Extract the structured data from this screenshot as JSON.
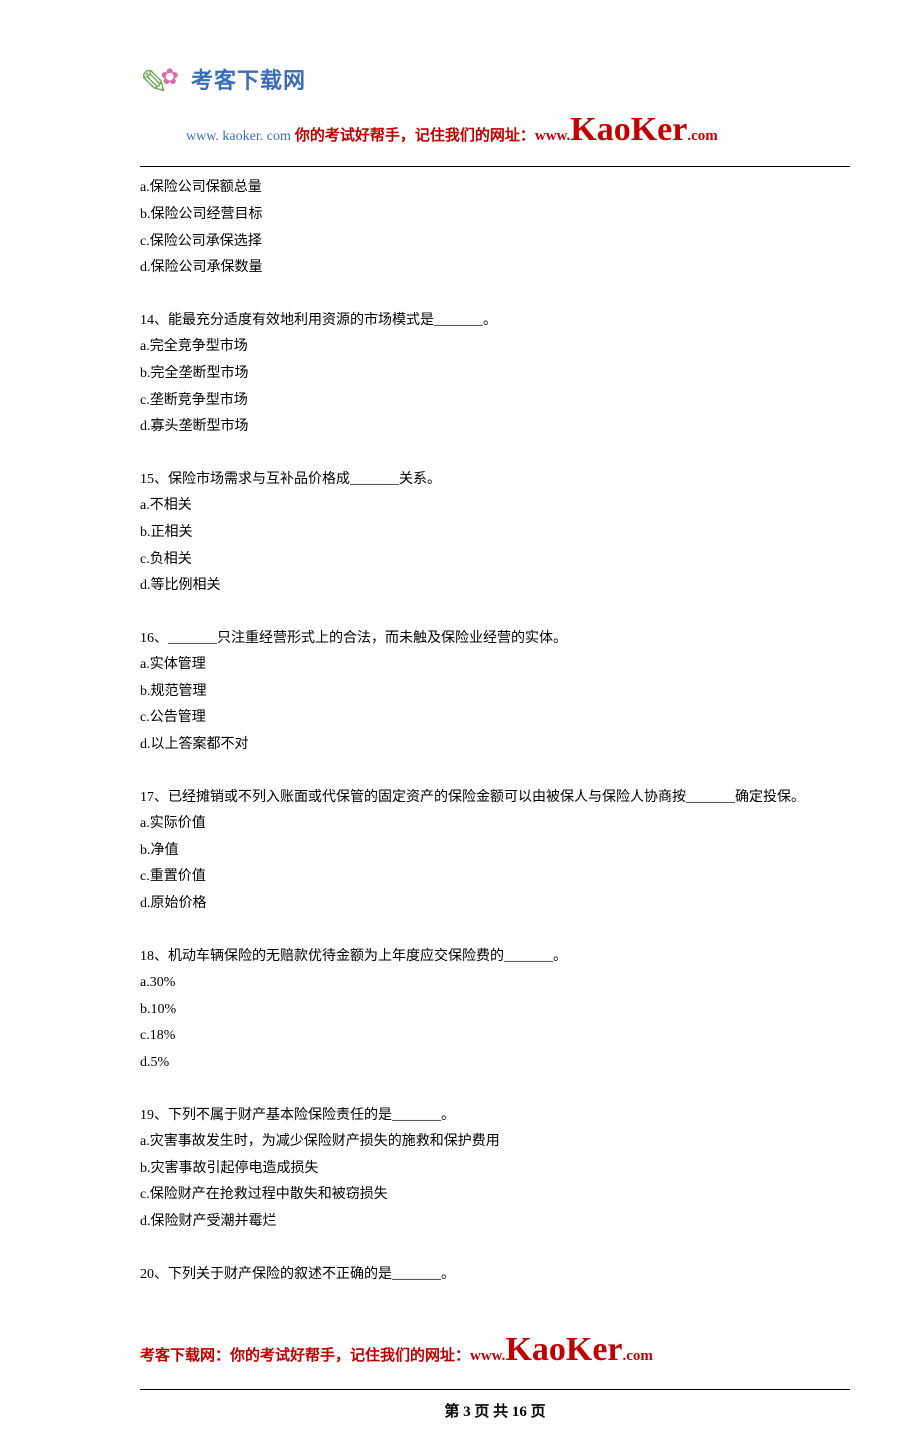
{
  "header": {
    "site_name_cn": "考客下载网",
    "site_url_small": "www. kaoker. com",
    "tagline_prefix": "你的考试好帮手，记住我们的网址：",
    "www": "www.",
    "brand": "KaoKer",
    "dotcom": ".com"
  },
  "prelude": {
    "a": "a.保险公司保额总量",
    "b": "b.保险公司经营目标",
    "c": "c.保险公司承保选择",
    "d": "d.保险公司承保数量"
  },
  "q14": {
    "stem": "14、能最充分适度有效地利用资源的市场模式是_______。",
    "a": "a.完全竞争型市场",
    "b": "b.完全垄断型市场",
    "c": "c.垄断竞争型市场",
    "d": "d.寡头垄断型市场"
  },
  "q15": {
    "stem": "15、保险市场需求与互补品价格成_______关系。",
    "a": "a.不相关",
    "b": "b.正相关",
    "c": "c.负相关",
    "d": "d.等比例相关"
  },
  "q16": {
    "stem": "16、_______只注重经营形式上的合法，而未触及保险业经营的实体。",
    "a": "a.实体管理",
    "b": "b.规范管理",
    "c": "c.公告管理",
    "d": "d.以上答案都不对"
  },
  "q17": {
    "stem": "17、已经摊销或不列入账面或代保管的固定资产的保险金额可以由被保人与保险人协商按_______确定投保。",
    "a": "a.实际价值",
    "b": "b.净值",
    "c": "c.重置价值",
    "d": "d.原始价格"
  },
  "q18": {
    "stem": "18、机动车辆保险的无赔款优待金额为上年度应交保险费的_______。",
    "a": "a.30%",
    "b": "b.10%",
    "c": "c.18%",
    "d": "d.5%"
  },
  "q19": {
    "stem": "19、下列不属于财产基本险保险责任的是_______。",
    "a": "a.灾害事故发生时，为减少保险财产损失的施救和保护费用",
    "b": "b.灾害事故引起停电造成损失",
    "c": "c.保险财产在抢救过程中散失和被窃损失",
    "d": "d.保险财产受潮并霉烂"
  },
  "q20": {
    "stem": "20、下列关于财产保险的叙述不正确的是_______。"
  },
  "footer": {
    "prefix": "考客下载网：你的考试好帮手，记住我们的网址：",
    "www": "www.",
    "brand": "KaoKer",
    "dotcom": ".com",
    "page_label": "第 3 页 共 16 页"
  }
}
